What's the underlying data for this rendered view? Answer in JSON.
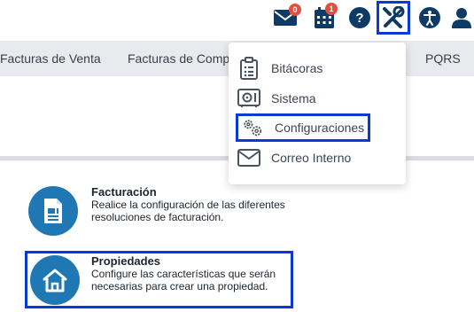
{
  "topbar": {
    "mail_count": "0",
    "calendar_count": "1",
    "icons": [
      "mail-icon",
      "calendar-icon",
      "help-icon",
      "tools-icon",
      "accessibility-icon",
      "user-icon"
    ]
  },
  "nav": {
    "items": [
      "Facturas de Venta",
      "Facturas de Comp",
      "PQRS"
    ]
  },
  "dropdown": {
    "items": [
      {
        "label": "Bitácoras",
        "icon": "clipboard-list-icon"
      },
      {
        "label": "Sistema",
        "icon": "safe-icon"
      },
      {
        "label": "Configuraciones",
        "icon": "gears-icon"
      },
      {
        "label": "Correo Interno",
        "icon": "envelope-icon"
      }
    ]
  },
  "cards": [
    {
      "title": "Facturación",
      "desc_line1": "Realice la configuración de las diferentes",
      "desc_line2": "resoluciones de facturación.",
      "icon": "invoice-icon"
    },
    {
      "title": "Propiedades",
      "desc_line1": "Configure las características que serán",
      "desc_line2": "necesarias para crear una propiedad.",
      "icon": "house-icon"
    }
  ],
  "colors": {
    "accent": "#1f78b4",
    "icon_dark": "#0d3b66",
    "badge": "#e74c3c",
    "highlight": "#0a3ad6",
    "nav_bg": "#e8eaee"
  }
}
